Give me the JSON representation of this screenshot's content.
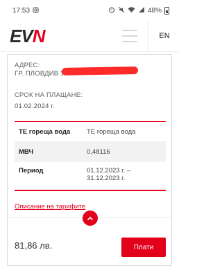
{
  "status_bar": {
    "time": "17:53",
    "battery": "48%"
  },
  "header": {
    "logo_ev": "EV",
    "logo_n": "N",
    "language": "EN"
  },
  "card": {
    "address_label": "АДРЕС:",
    "address_value": "ГР. ПЛОВДИВ У",
    "due_label": "СРОК НА ПЛАЩАНЕ:",
    "due_value": "01.02.2024 г.",
    "table": {
      "rows": [
        {
          "name": "ТЕ гореща вода",
          "value": "ТЕ гореща вода"
        },
        {
          "name": "МВЧ",
          "value": "0,48116"
        },
        {
          "name": "Период",
          "value_line1": "01.12.2023 г. –",
          "value_line2": "31.12.2023 г."
        }
      ]
    },
    "tariff_link": "Описание на тарифите",
    "amount": "81,86 лв.",
    "pay_button": "Плати"
  },
  "colors": {
    "accent": "#e2001a",
    "redaction": "#ff2a2a"
  },
  "icons": [
    "instagram-icon",
    "alarm-icon",
    "mute-icon",
    "wifi-icon",
    "signal-icon",
    "battery-icon",
    "menu-icon",
    "chevron-up-icon"
  ]
}
